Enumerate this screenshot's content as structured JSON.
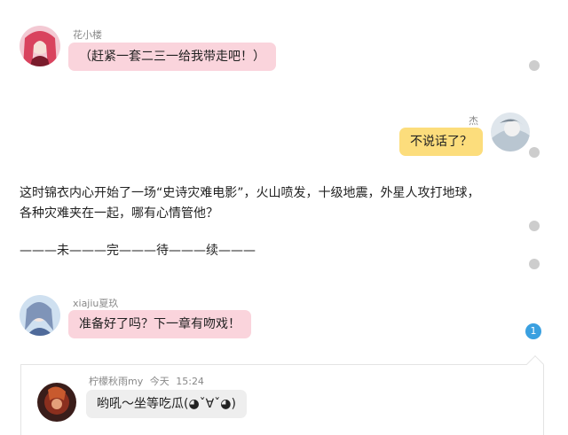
{
  "messages": [
    {
      "author": "花小楼",
      "text": "（赶紧一套二三一给我带走吧！）",
      "side": "left",
      "color": "pink"
    },
    {
      "author": "杰",
      "text": "不说话了？",
      "side": "right",
      "color": "yellow"
    },
    {
      "author": "xiajiu夏玖",
      "text": "准备好了吗？下一章有吻戏！",
      "side": "left",
      "color": "pink"
    }
  ],
  "narration": {
    "line1": "这时锦衣内心开始了一场“史诗灾难电影”，火山喷发，十级地震，外星人攻打地球，",
    "line2": "各种灾难夹在一起，哪有心情管他？",
    "tbc": "———未———完———待———续———"
  },
  "comment_count": "1",
  "comment": {
    "author": "柠檬秋雨my",
    "date": "今天",
    "time": "15:24",
    "text": "哟吼～坐等吃瓜(◕ˇ∀ˇ◕)"
  }
}
